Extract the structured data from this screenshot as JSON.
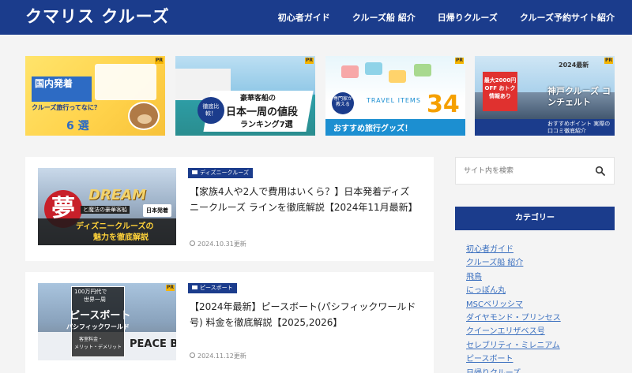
{
  "header": {
    "logo": "クマリス クルーズ",
    "nav": [
      "初心者ガイド",
      "クルーズ船 紹介",
      "日帰りクルーズ",
      "クルーズ予約サイト紹介"
    ],
    "background": "#1b3c8c"
  },
  "pickup": {
    "banner1": {
      "title": "国内発着",
      "subtitle": "クルーズ旅行ってなに？",
      "count_label": "6 選",
      "character": "bear-mascot"
    },
    "banner2": {
      "badge": "徹底比較！",
      "line1": "豪華客船の",
      "line2": "日本一周の値段",
      "line3": "ランキング7選"
    },
    "banner3": {
      "badge": "専門家が教える",
      "sub": "TRAVEL ITEMS",
      "count": "34",
      "count_unit": "選",
      "caption": "おすすめ旅行グッズ！"
    },
    "banner4": {
      "year": "2024最新",
      "tag": "最大2000円 OFF おトク情報あり",
      "title": "神戸クルーズ コンチェルト",
      "caption": "おすすめポイント 実際の口コミ徹底紹介"
    },
    "pr_label": "PR"
  },
  "articles": [
    {
      "category": "ディズニークルーズ",
      "title": "【家族4人や2人で費用はいくら？】日本発着ディズニークルーズ ラインを徹底解説【2024年11月最新】",
      "date": "2024.10.31更新",
      "thumb": {
        "kanji": "夢",
        "logo_text": "DREAM",
        "label": "と魔法の豪華客船",
        "origin": "日本発着",
        "line1": "ディズニークルーズの",
        "line2": "魅力を徹底解説"
      }
    },
    {
      "category": "ピースボート",
      "title": "【2024年最新】ピースボート(パシフィックワールド号) 料金を徹底解説【2025,2026】",
      "date": "2024.11.12更新",
      "thumb": {
        "a": "100万円代で",
        "b": "世界一周",
        "c": "ピースボート",
        "d": "パシフィックワールド",
        "e": "客室料金・",
        "f": "メリット・デメリット",
        "g": "PEACE B"
      }
    }
  ],
  "sidebar": {
    "search_placeholder": "サイト内を検索",
    "category_heading": "カテゴリー",
    "categories": [
      "初心者ガイド",
      "クルーズ船 紹介",
      "飛鳥",
      "にっぽん丸",
      "MSCベリッシマ",
      "ダイヤモンド・プリンセス",
      "クイーンエリザベス号",
      "セレブリティ・ミレニアム",
      "ピースボート",
      "日帰りクルーズ"
    ]
  },
  "colors": {
    "accent": "#1b3c8c",
    "link": "#3a6fbf",
    "page_bg": "#f4f4f4"
  }
}
